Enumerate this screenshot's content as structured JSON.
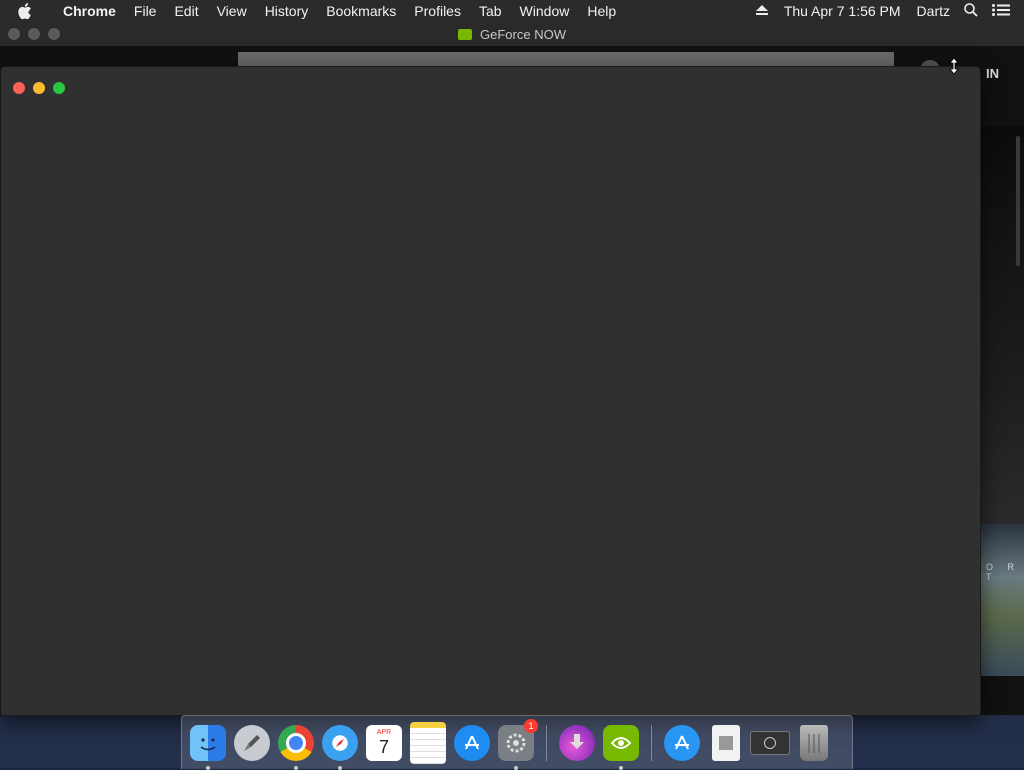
{
  "menubar": {
    "app_name": "Chrome",
    "items": [
      "File",
      "Edit",
      "View",
      "History",
      "Bookmarks",
      "Profiles",
      "Tab",
      "Window",
      "Help"
    ],
    "clock": "Thu Apr 7  1:56 PM",
    "user": "Dartz"
  },
  "background_window": {
    "title": "GeForce NOW",
    "signin_fragment": "IN",
    "thumb_text": "O R T"
  },
  "dock": {
    "calendar_month": "APR",
    "calendar_day": "7",
    "settings_badge": "1"
  },
  "colors": {
    "close": "#fc5f57",
    "minimize": "#fdbc2e",
    "zoom": "#28c840",
    "nvidia_green": "#76b900"
  }
}
